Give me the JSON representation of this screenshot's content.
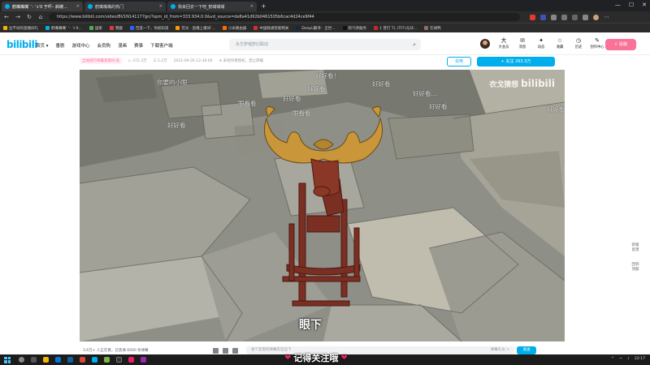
{
  "browser": {
    "tabs": [
      {
        "title": "鹤嘴嘴嘴‘ ‘- ’ɔ‘0 于吓– 斜坡..."
      },
      {
        "title": "鹤嘴嘴嘴的热门"
      },
      {
        "title": "我来回去一下吧_鹤嘴嘴嘴"
      }
    ],
    "url": "https://www.bilibili.com/video/BV1N141177gn/?spm_id_from=333.934.0.0&vd_source=de8a41d92b0461505b6cac4d24ce9f44",
    "bookmarks": [
      "丝不动的直播间礼",
      "鹤嘴嘴嘴‘ ’- ’ɔ‘0...",
      "国家",
      "我酸",
      "百度一下，你就知道",
      "荧光 · 直播上播间‘...",
      "小米路由器",
      "中国联通智能网关",
      "DeepL翻译：全世...",
      "新汽改服务",
      "1 普打 TL (TFF)与块...",
      "在胡鸭"
    ]
  },
  "site": {
    "logo": "bilibili",
    "nav": [
      "首页 ▾",
      "番剧",
      "游戏中心",
      "会员购",
      "漫画",
      "赛事",
      "下载客户端"
    ],
    "search_placeholder": "永华梦唱梦幻联动",
    "right_nav": [
      {
        "icon": "大",
        "label": "大会员"
      },
      {
        "icon": "✉",
        "label": "消息"
      },
      {
        "icon": "✦",
        "label": "动态"
      },
      {
        "icon": "☆",
        "label": "收藏"
      },
      {
        "icon": "◷",
        "label": "历史"
      },
      {
        "icon": "✎",
        "label": "创作中心"
      }
    ],
    "upload_label": "投稿"
  },
  "video_info": {
    "rank": "全站排行榜最高第81名",
    "views": "372.3万",
    "danmaku_count": "5.2万",
    "date": "2022-09-26 12:38:00",
    "notice": "未经作者授权，禁止转载",
    "charge_label": "充电",
    "follow_label": "+ 关注 263.3万"
  },
  "video": {
    "danmaku": [
      "你要的小眼",
      "好好看！",
      "好好看",
      "好好看...",
      "好好看",
      "好好看",
      "好好看",
      "眼看看",
      "好好看",
      "眼看看",
      "好好看"
    ],
    "watermark": "衣戈猜想",
    "subtitle": "眼下"
  },
  "player": {
    "viewers_text": "3.6万+ 人正在看，已装填 6000 条弹幕",
    "danmaku_placeholder": "发个友善的弹幕见证当下",
    "etiquette": "弹幕礼仪 >",
    "send_label": "发送"
  },
  "side_float": [
    "新版",
    "反馈",
    "回到",
    "顶部"
  ],
  "overlay_banner": "记得关注哦",
  "clock": "22:17",
  "colors": {
    "brand": "#00aeec",
    "pink": "#fb7299"
  }
}
